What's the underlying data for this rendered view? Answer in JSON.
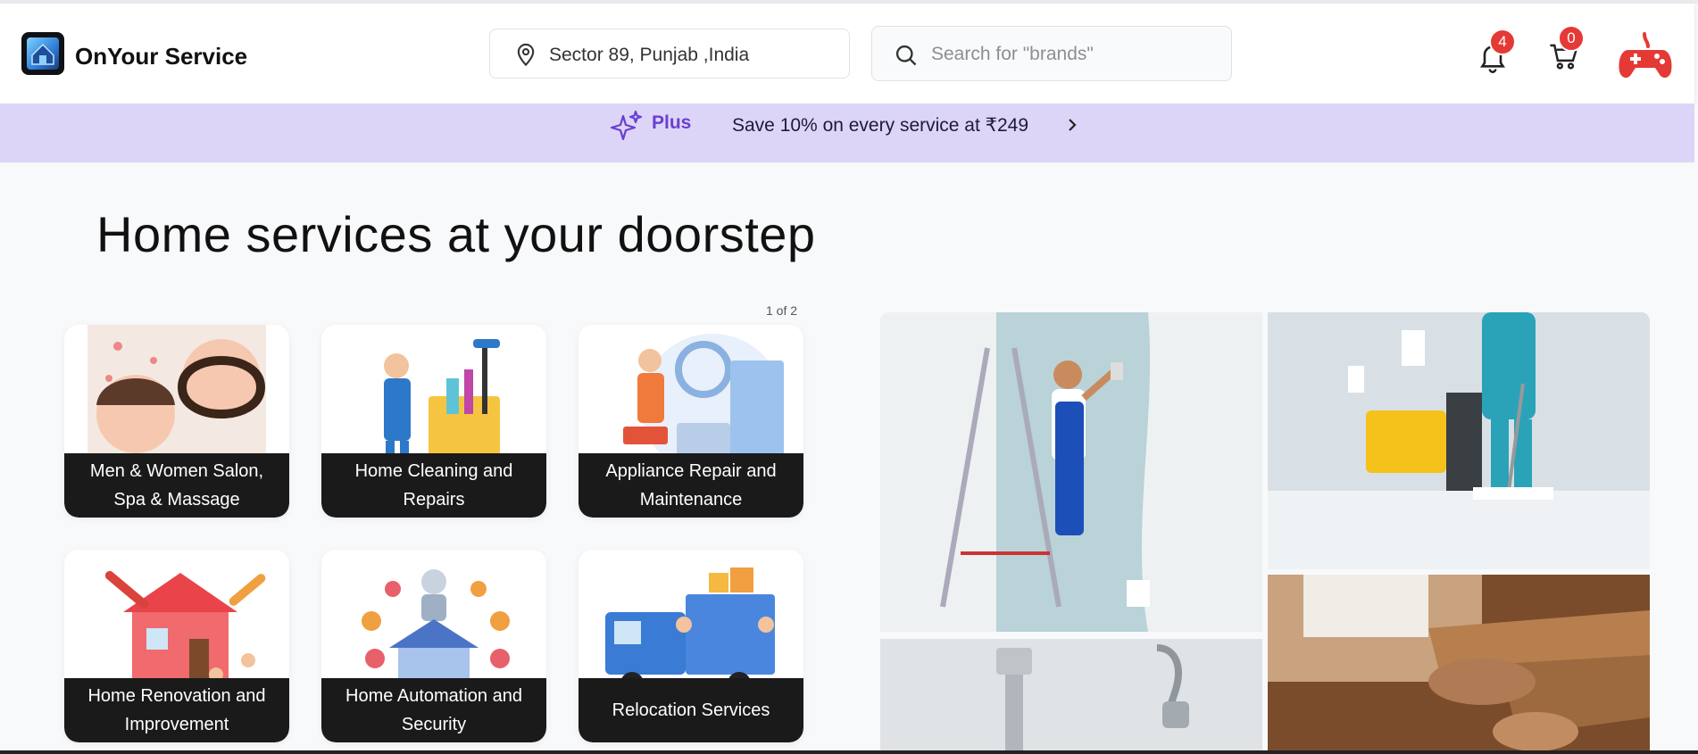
{
  "header": {
    "brand": "OnYour Service",
    "location": "Sector 89, Punjab ,India",
    "search_placeholder": "Search for \"brands\"",
    "notifications_count": "4",
    "cart_count": "0"
  },
  "promo": {
    "badge": "Plus",
    "text": "Save 10% on every service at ₹249"
  },
  "main": {
    "headline": "Home services at your doorstep",
    "pager": "1 of 2",
    "categories": [
      {
        "label": "Men & Women Salon, Spa & Massage"
      },
      {
        "label": "Home Cleaning and Repairs"
      },
      {
        "label": "Appliance Repair and Maintenance"
      },
      {
        "label": "Home Renovation and Improvement"
      },
      {
        "label": "Home Automation and Security"
      },
      {
        "label": "Relocation Services"
      }
    ]
  },
  "colors": {
    "promo_bg": "#ddd5f7",
    "promo_accent": "#6a3fd1",
    "badge_red": "#e53935",
    "card_label_bg": "#1a1a1a"
  }
}
